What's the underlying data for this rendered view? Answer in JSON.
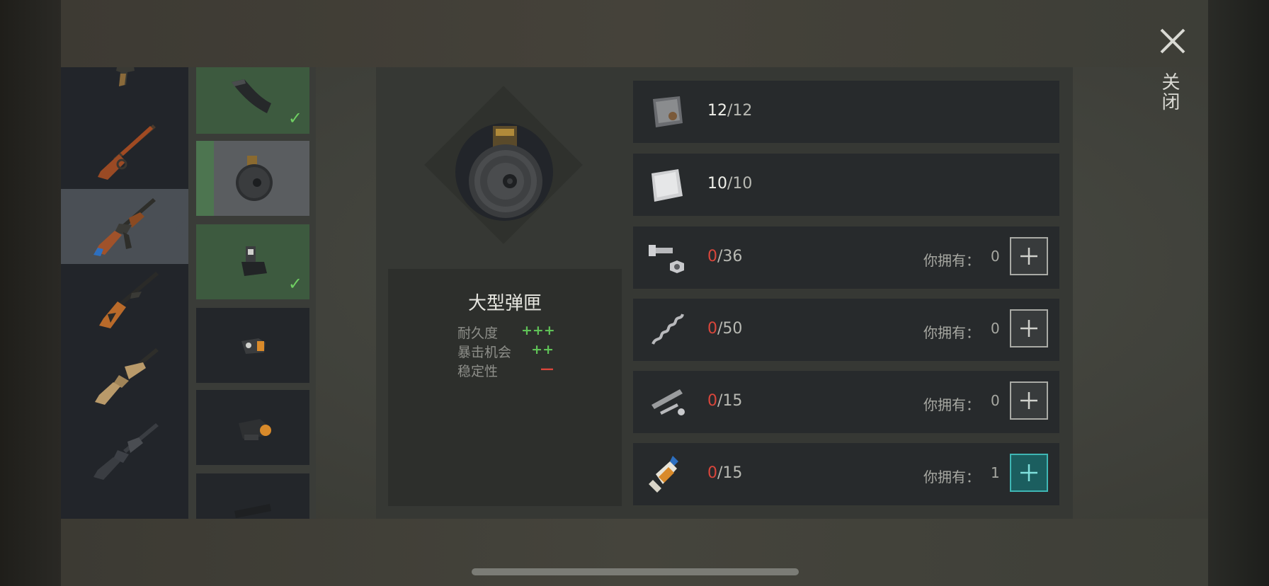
{
  "close": {
    "label": "关闭",
    "icon": "close-icon"
  },
  "weapons": [
    {
      "name": "pistol",
      "icon": "pistol-icon",
      "selected": false
    },
    {
      "name": "lever-action-rifle",
      "icon": "lever-rifle-icon",
      "selected": false
    },
    {
      "name": "ak-rifle",
      "icon": "ak-rifle-icon",
      "selected": true
    },
    {
      "name": "svd-rifle",
      "icon": "dragunov-icon",
      "selected": false
    },
    {
      "name": "scar-rifle",
      "icon": "scar-rifle-icon",
      "selected": false
    },
    {
      "name": "m16-rifle",
      "icon": "m16-rifle-icon",
      "selected": false
    }
  ],
  "attachments": [
    {
      "icon": "curved-magazine-icon",
      "state": "installed"
    },
    {
      "icon": "drum-magazine-icon",
      "state": "current"
    },
    {
      "icon": "rear-sight-icon",
      "state": "installed"
    },
    {
      "icon": "red-dot-sight-icon",
      "state": "none"
    },
    {
      "icon": "holographic-sight-icon",
      "state": "none"
    },
    {
      "icon": "scope-icon",
      "state": "none"
    }
  ],
  "detail": {
    "title": "大型弹匣",
    "stats": [
      {
        "label": "耐久度",
        "value": "+++",
        "color": "#5fc257"
      },
      {
        "label": "暴击机会",
        "value": "++",
        "color": "#5fc257"
      },
      {
        "label": "稳定性",
        "value": "—",
        "color": "#d9463b"
      }
    ]
  },
  "requirements": [
    {
      "icon": "metal-plate-icon",
      "have": "12",
      "need": "12",
      "sufficient": true,
      "own_label": "",
      "own_value": "",
      "button": "none"
    },
    {
      "icon": "aluminum-plate-icon",
      "have": "10",
      "need": "10",
      "sufficient": true,
      "own_label": "",
      "own_value": "",
      "button": "none"
    },
    {
      "icon": "bolts-nuts-icon",
      "have": "0",
      "need": "36",
      "sufficient": false,
      "own_label": "你拥有：",
      "own_value": "0",
      "button": "normal"
    },
    {
      "icon": "spring-icon",
      "have": "0",
      "need": "50",
      "sufficient": false,
      "own_label": "你拥有：",
      "own_value": "0",
      "button": "normal"
    },
    {
      "icon": "weapon-parts-icon",
      "have": "0",
      "need": "15",
      "sufficient": false,
      "own_label": "你拥有：",
      "own_value": "0",
      "button": "normal"
    },
    {
      "icon": "glue-icon",
      "have": "0",
      "need": "15",
      "sufficient": false,
      "own_label": "你拥有：",
      "own_value": "1",
      "button": "active"
    }
  ],
  "colors": {
    "insufficient": "#d9463b",
    "positive": "#5fc257",
    "accent": "#3fb6b4"
  }
}
